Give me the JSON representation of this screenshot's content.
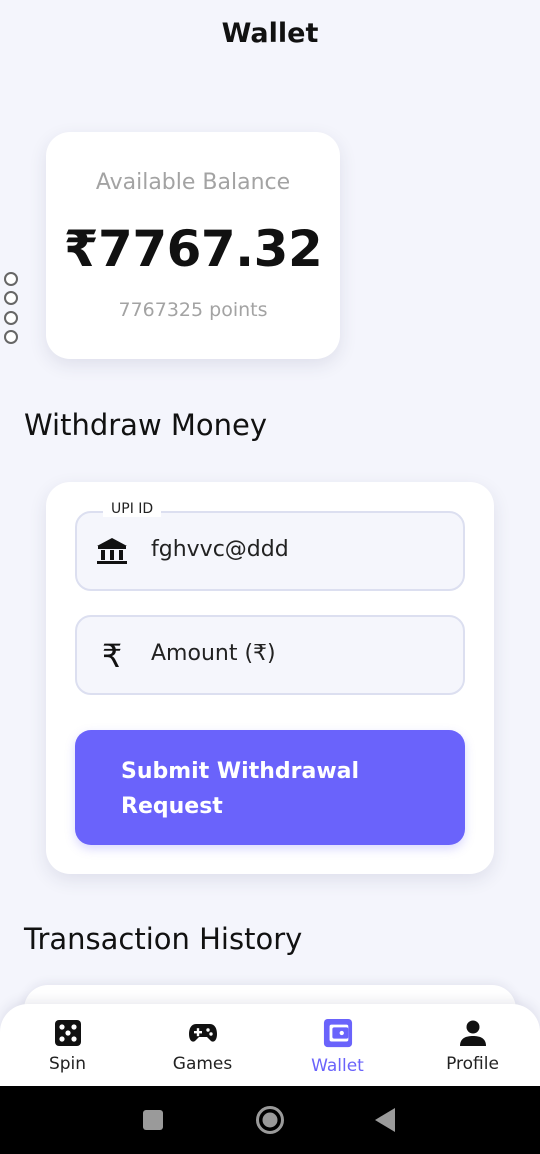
{
  "app": {
    "title": "Wallet"
  },
  "balance": {
    "label": "Available Balance",
    "amount": "₹7767.32",
    "points": "7767325 points"
  },
  "withdraw": {
    "section_title": "Withdraw Money",
    "upi_field": {
      "label": "UPI ID",
      "value": "fghvvc@ddd",
      "icon": "bank-icon"
    },
    "amount_field": {
      "placeholder": "Amount (₹)",
      "icon": "rupee-icon",
      "glyph": "₹"
    },
    "submit_label_line1": "Submit Withdrawal",
    "submit_label_line2": "Request"
  },
  "history": {
    "section_title": "Transaction History"
  },
  "bottom_nav": {
    "items": [
      {
        "label": "Spin",
        "icon": "dice-icon"
      },
      {
        "label": "Games",
        "icon": "gamepad-icon"
      },
      {
        "label": "Wallet",
        "icon": "wallet-icon",
        "active": true
      },
      {
        "label": "Profile",
        "icon": "person-icon"
      }
    ]
  },
  "colors": {
    "accent": "#6a63fb",
    "background": "#f4f5fc",
    "card": "#ffffff",
    "muted_text": "#a3a3a3"
  }
}
